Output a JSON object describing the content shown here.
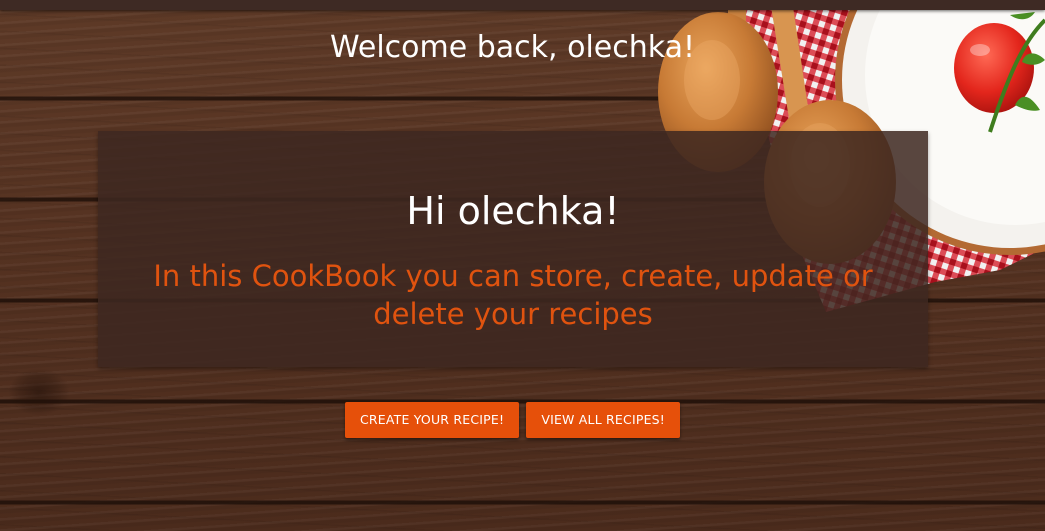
{
  "header": {
    "welcome": "Welcome back, olechka!"
  },
  "card": {
    "greeting": "Hi olechka!",
    "description": "In this CookBook you can store, create, update or delete your recipes"
  },
  "actions": {
    "create_label": "CREATE YOUR RECIPE!",
    "view_all_label": "VIEW ALL RECIPES!"
  },
  "colors": {
    "accent": "#e6500a",
    "card_background": "#3e2821",
    "top_bar": "#3e2a24",
    "description_text": "#e0530f"
  },
  "decorations": [
    "wood-background",
    "tablecloth",
    "plate-icon",
    "wooden-spoon-icon",
    "tomato-icon"
  ]
}
